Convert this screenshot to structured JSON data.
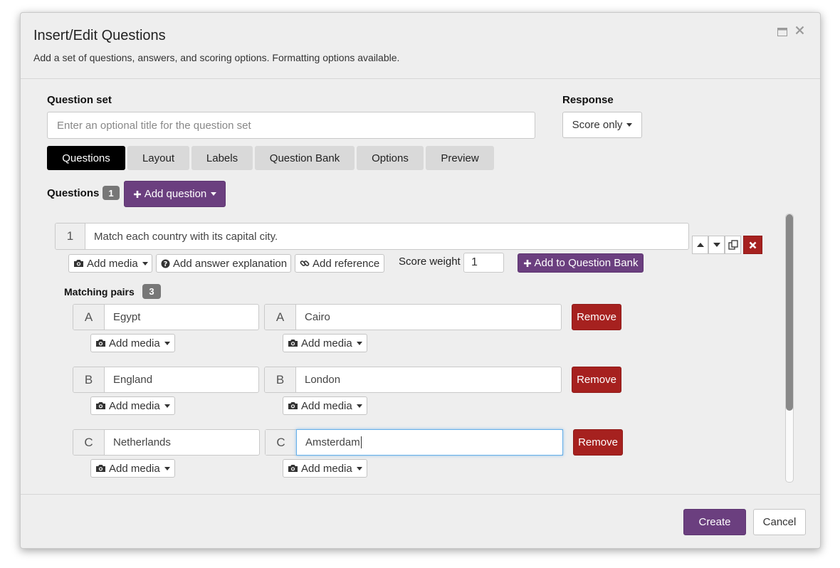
{
  "dialog": {
    "title": "Insert/Edit Questions",
    "subtitle": "Add a set of questions, answers, and scoring options. Formatting options available."
  },
  "question_set": {
    "label": "Question set",
    "placeholder": "Enter an optional title for the question set"
  },
  "response": {
    "label": "Response",
    "selected": "Score only"
  },
  "tabs": [
    {
      "label": "Questions",
      "active": true
    },
    {
      "label": "Layout",
      "active": false
    },
    {
      "label": "Labels",
      "active": false
    },
    {
      "label": "Question Bank",
      "active": false
    },
    {
      "label": "Options",
      "active": false
    },
    {
      "label": "Preview",
      "active": false
    }
  ],
  "questions": {
    "label": "Questions",
    "count": "1",
    "add_label": "Add question"
  },
  "question": {
    "number": "1",
    "text": "Match each country with its capital city.",
    "add_media": "Add media",
    "add_explanation": "Add answer explanation",
    "add_reference": "Add reference",
    "score_weight_label": "Score weight",
    "score_weight": "1",
    "add_to_bank": "Add to Question Bank"
  },
  "matching": {
    "label": "Matching pairs",
    "count": "3",
    "add_media": "Add media",
    "remove_label": "Remove",
    "pairs": [
      {
        "letter": "A",
        "left": "Egypt",
        "right": "Cairo"
      },
      {
        "letter": "B",
        "left": "England",
        "right": "London"
      },
      {
        "letter": "C",
        "left": "Netherlands",
        "right": "Amsterdam"
      }
    ]
  },
  "footer": {
    "create": "Create",
    "cancel": "Cancel"
  },
  "colors": {
    "accent_purple": "#6b3f7f",
    "danger_red": "#a6211f",
    "active_tab": "#000000",
    "dialog_bg": "#eeeeee"
  },
  "icons": [
    "maximize-icon",
    "close-icon",
    "plus-icon",
    "camera-icon",
    "question-circle-icon",
    "link-icon",
    "arrow-up-icon",
    "arrow-down-icon",
    "copy-icon",
    "delete-x-icon",
    "caret-down-icon"
  ]
}
